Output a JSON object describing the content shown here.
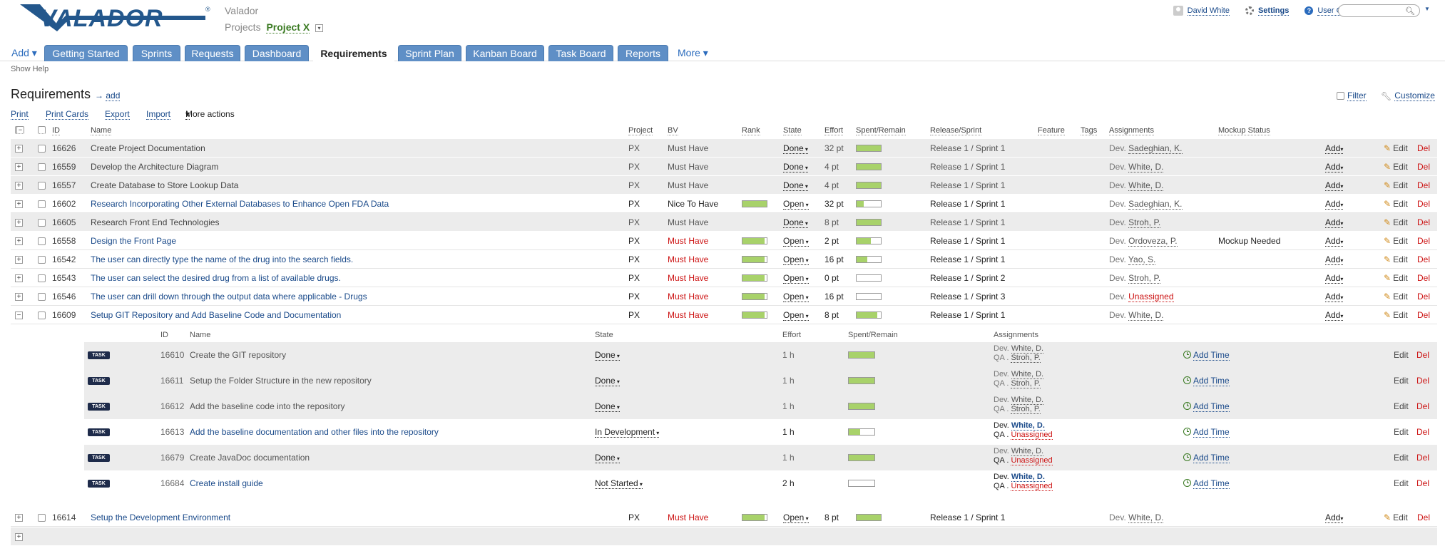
{
  "header": {
    "company": "Valador",
    "projects_label": "Projects",
    "project_name": "Project X",
    "user": "David White",
    "settings": "Settings",
    "user_guide": "User Guide",
    "logo_text": "VALADOR"
  },
  "tabs": {
    "add": "Add",
    "items": [
      "Getting Started",
      "Sprints",
      "Requests",
      "Dashboard",
      "Requirements",
      "Sprint Plan",
      "Kanban Board",
      "Task Board",
      "Reports"
    ],
    "more": "More",
    "active": "Requirements"
  },
  "show_help": "Show Help",
  "page": {
    "title": "Requirements",
    "add_link": "add",
    "filter": "Filter",
    "customize": "Customize"
  },
  "actions": [
    "Print",
    "Print Cards",
    "Export",
    "Import",
    "More actions"
  ],
  "columns": [
    "ID",
    "Name",
    "Project",
    "BV",
    "Rank",
    "State",
    "Effort",
    "Spent/Remain",
    "Release/Sprint",
    "Feature",
    "Tags",
    "Assignments",
    "Mockup Status"
  ],
  "labels": {
    "add": "Add",
    "edit": "Edit",
    "del": "Del",
    "dev": "Dev.",
    "qa": "QA .",
    "add_time": "Add Time",
    "task": "TASK"
  },
  "rows": [
    {
      "id": "16626",
      "name": "Create Project Documentation",
      "project": "PX",
      "bv": "Must Have",
      "rank": null,
      "state": "Done",
      "effort": "32 pt",
      "spent": 1.0,
      "release": "Release 1 / Sprint 1",
      "assignee": "Sadeghian, K.",
      "mockup": ""
    },
    {
      "id": "16559",
      "name": "Develop the Architecture Diagram",
      "project": "PX",
      "bv": "Must Have",
      "rank": null,
      "state": "Done",
      "effort": "4 pt",
      "spent": 1.0,
      "release": "Release 1 / Sprint 1",
      "assignee": "White, D.",
      "mockup": ""
    },
    {
      "id": "16557",
      "name": "Create Database to Store Lookup Data",
      "project": "PX",
      "bv": "Must Have",
      "rank": null,
      "state": "Done",
      "effort": "4 pt",
      "spent": 1.0,
      "release": "Release 1 / Sprint 1",
      "assignee": "White, D.",
      "mockup": ""
    },
    {
      "id": "16602",
      "name": "Research Incorporating Other External Databases to Enhance Open FDA Data",
      "project": "PX",
      "bv": "Nice To Have",
      "rank": 1.0,
      "state": "Open",
      "effort": "32 pt",
      "spent": 0.3,
      "release": "Release 1 / Sprint 1",
      "assignee": "Sadeghian, K.",
      "mockup": ""
    },
    {
      "id": "16605",
      "name": "Research Front End Technologies",
      "project": "PX",
      "bv": "Must Have",
      "rank": null,
      "state": "Done",
      "effort": "8 pt",
      "spent": 1.0,
      "release": "Release 1 / Sprint 1",
      "assignee": "Stroh, P.",
      "mockup": ""
    },
    {
      "id": "16558",
      "name": "Design the Front Page",
      "project": "PX",
      "bv": "Must Have",
      "rank": 0.9,
      "state": "Open",
      "effort": "2 pt",
      "spent": 0.6,
      "release": "Release 1 / Sprint 1",
      "assignee": "Ordoveza, P.",
      "mockup": "Mockup Needed"
    },
    {
      "id": "16542",
      "name": "The user can directly type the name of the drug into the search fields.",
      "project": "PX",
      "bv": "Must Have",
      "rank": 0.9,
      "state": "Open",
      "effort": "16 pt",
      "spent": 0.45,
      "release": "Release 1 / Sprint 1",
      "assignee": "Yao, S.",
      "mockup": ""
    },
    {
      "id": "16543",
      "name": "The user can select the desired drug from a list of available drugs.",
      "project": "PX",
      "bv": "Must Have",
      "rank": 0.9,
      "state": "Open",
      "effort": "0 pt",
      "spent": 0.0,
      "release": "Release 1 / Sprint 2",
      "assignee": "Stroh, P.",
      "mockup": ""
    },
    {
      "id": "16546",
      "name": "The user can drill down through the output data where applicable - Drugs",
      "project": "PX",
      "bv": "Must Have",
      "rank": 0.9,
      "state": "Open",
      "effort": "16 pt",
      "spent": 0.0,
      "release": "Release 1 / Sprint 3",
      "assignee": "Unassigned",
      "mockup": ""
    },
    {
      "id": "16609",
      "name": "Setup GIT Repository and Add Baseline Code and Documentation",
      "project": "PX",
      "bv": "Must Have",
      "rank": 0.9,
      "state": "Open",
      "effort": "8 pt",
      "spent": 0.85,
      "release": "Release 1 / Sprint 1",
      "assignee": "White, D.",
      "mockup": "",
      "expanded": true
    }
  ],
  "subtask_columns": [
    "ID",
    "Name",
    "State",
    "Effort",
    "Spent/Remain",
    "Assignments"
  ],
  "subtasks": [
    {
      "id": "16610",
      "name": "Create the GIT repository",
      "state": "Done",
      "effort": "1 h",
      "spent": 1.0,
      "dev": "White, D.",
      "qa": "Stroh, P."
    },
    {
      "id": "16611",
      "name": "Setup the Folder Structure in the new repository",
      "state": "Done",
      "effort": "1 h",
      "spent": 1.0,
      "dev": "White, D.",
      "qa": "Stroh, P."
    },
    {
      "id": "16612",
      "name": "Add the baseline code into the repository",
      "state": "Done",
      "effort": "1 h",
      "spent": 1.0,
      "dev": "White, D.",
      "qa": "Stroh, P."
    },
    {
      "id": "16613",
      "name": "Add the baseline documentation and other files into the repository",
      "state": "In Development",
      "effort": "1 h",
      "spent": 0.45,
      "dev": "White, D.",
      "qa": "Unassigned"
    },
    {
      "id": "16679",
      "name": "Create JavaDoc documentation",
      "state": "Done",
      "effort": "1 h",
      "spent": 1.0,
      "dev": "White, D.",
      "qa": "Unassigned"
    },
    {
      "id": "16684",
      "name": "Create install guide",
      "state": "Not Started",
      "effort": "2 h",
      "spent": 0.0,
      "dev": "White, D.",
      "qa": "Unassigned"
    }
  ],
  "last_row": {
    "id": "16614",
    "name": "Setup the Development Environment",
    "project": "PX",
    "bv": "Must Have",
    "rank": 0.9,
    "state": "Open",
    "effort": "8 pt",
    "spent": 1.0,
    "release": "Release 1 / Sprint 1",
    "assignee": "White, D."
  },
  "colors": {
    "tab": "#5f8fc6",
    "link": "#1a4a8a",
    "red": "#cc1111",
    "bar": "#a8d26a",
    "task_badge": "#1e2b4a"
  }
}
